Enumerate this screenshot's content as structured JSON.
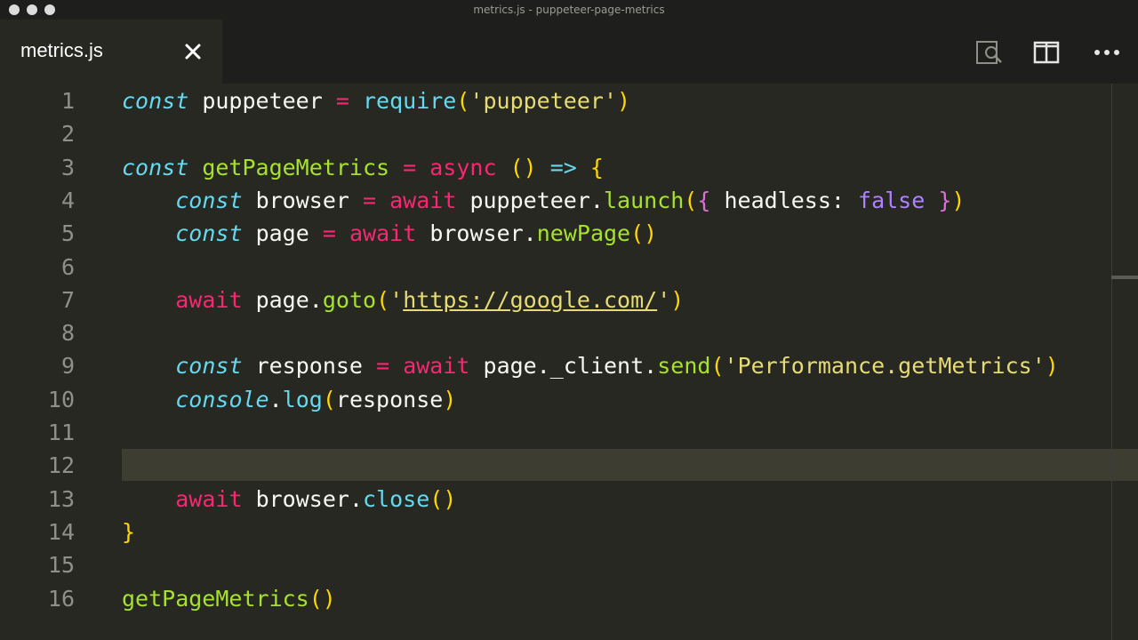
{
  "window": {
    "title": "metrics.js - puppeteer-page-metrics"
  },
  "tab": {
    "label": "metrics.js",
    "close_icon": "close-icon"
  },
  "actions": [
    "open-changes-icon",
    "split-editor-icon",
    "more-actions-icon"
  ],
  "editor": {
    "language": "javascript",
    "current_line": 12,
    "lines": [
      {
        "num": "1",
        "code": "const puppeteer = require('puppeteer')"
      },
      {
        "num": "2",
        "code": ""
      },
      {
        "num": "3",
        "code": "const getPageMetrics = async () => {"
      },
      {
        "num": "4",
        "code": "    const browser = await puppeteer.launch({ headless: false })"
      },
      {
        "num": "5",
        "code": "    const page = await browser.newPage()"
      },
      {
        "num": "6",
        "code": ""
      },
      {
        "num": "7",
        "code": "    await page.goto('https://google.com/')"
      },
      {
        "num": "8",
        "code": ""
      },
      {
        "num": "9",
        "code": "    const response = await page._client.send('Performance.getMetrics')"
      },
      {
        "num": "10",
        "code": "    console.log(response)"
      },
      {
        "num": "11",
        "code": ""
      },
      {
        "num": "12",
        "code": ""
      },
      {
        "num": "13",
        "code": "    await browser.close()"
      },
      {
        "num": "14",
        "code": "}"
      },
      {
        "num": "15",
        "code": ""
      },
      {
        "num": "16",
        "code": "getPageMetrics()"
      }
    ]
  },
  "colors": {
    "background": "#272822",
    "keyword": "#f92672",
    "storage": "#66d9ef",
    "function": "#a6e22e",
    "string": "#e6db74",
    "constant": "#ae81ff"
  }
}
